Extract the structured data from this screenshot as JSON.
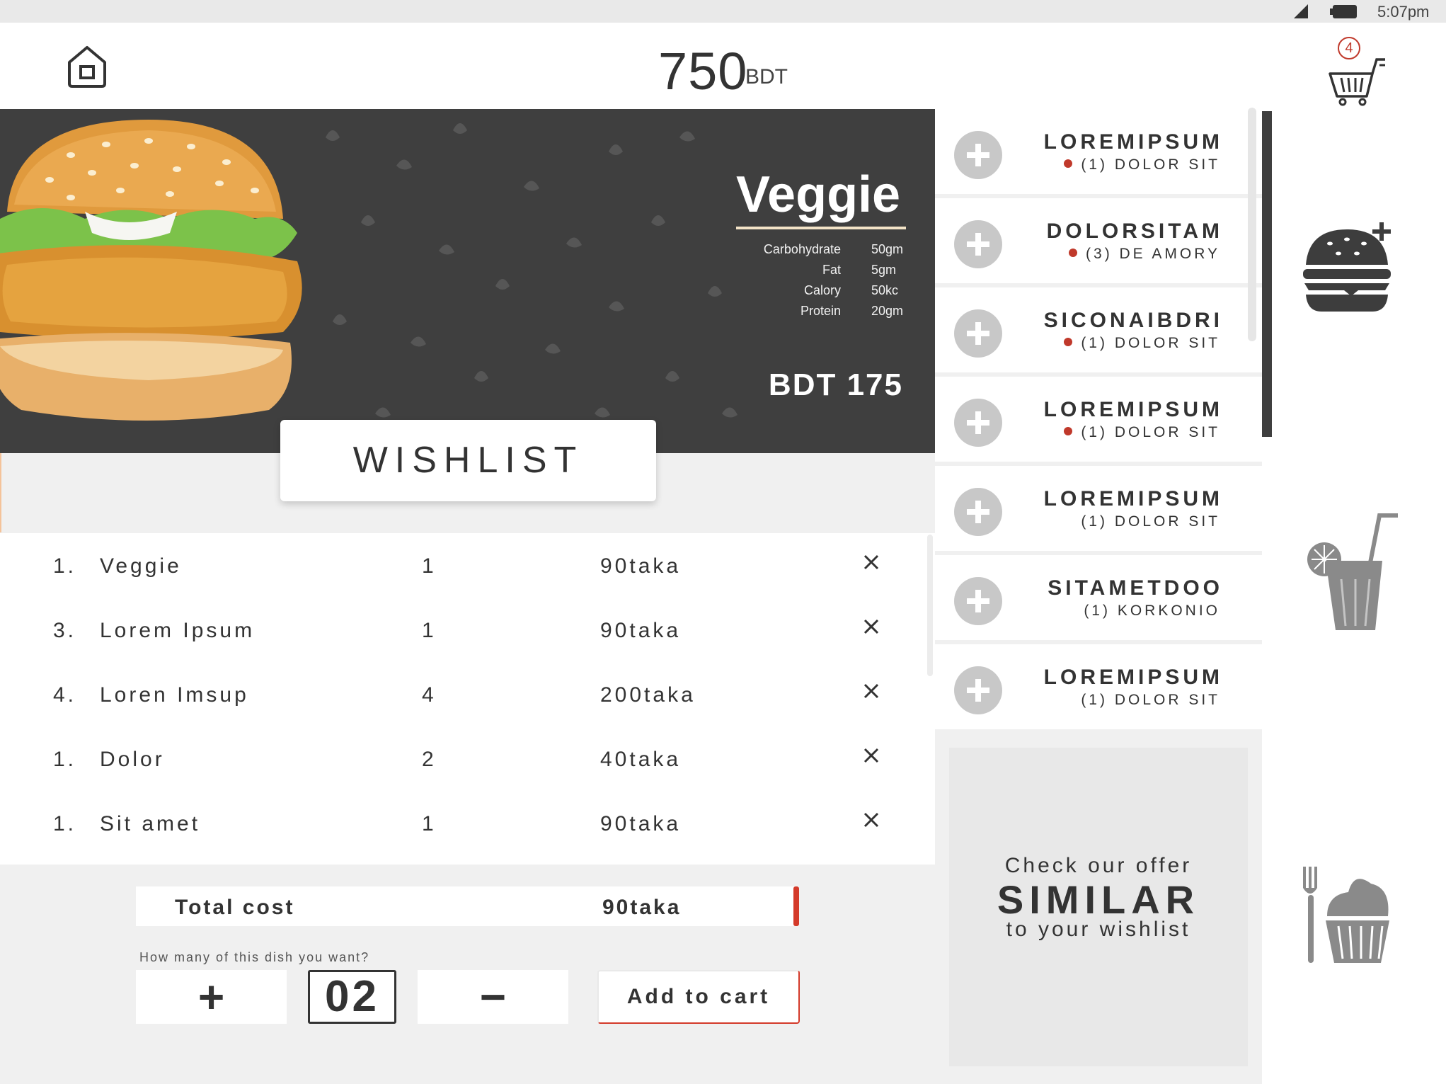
{
  "status": {
    "time": "5:07pm"
  },
  "header": {
    "balance": "750",
    "balance_unit": "BDT",
    "cart_count": "4"
  },
  "hero": {
    "title": "Veggie",
    "nutrition": [
      {
        "label": "Carbohydrate",
        "value": "50gm"
      },
      {
        "label": "Fat",
        "value": "5gm"
      },
      {
        "label": "Calory",
        "value": "50kc"
      },
      {
        "label": "Protein",
        "value": "20gm"
      }
    ],
    "price": "BDT 175"
  },
  "wishlist_tab": "WISHLIST",
  "wishlist": [
    {
      "idx": "1.",
      "name": "Veggie",
      "qty": "1",
      "price": "90taka"
    },
    {
      "idx": "3.",
      "name": "Lorem Ipsum",
      "qty": "1",
      "price": "90taka"
    },
    {
      "idx": "4.",
      "name": "Loren Imsup",
      "qty": "4",
      "price": "200taka"
    },
    {
      "idx": "1.",
      "name": "Dolor",
      "qty": "2",
      "price": "40taka"
    },
    {
      "idx": "1.",
      "name": "Sit amet",
      "qty": "1",
      "price": "90taka"
    }
  ],
  "total": {
    "label": "Total cost",
    "value": "90taka"
  },
  "quantity": {
    "question": "How many of this dish you want?",
    "value": "02",
    "plus": "+",
    "minus": "−"
  },
  "add_to_cart": "Add to cart",
  "menu": [
    {
      "name": "LOREMIPSUM",
      "sub": "(1) DOLOR SIT",
      "dot": true
    },
    {
      "name": "DOLORSITAM",
      "sub": "(3) DE AMORY",
      "dot": true
    },
    {
      "name": "SICONAIBDRI",
      "sub": "(1) DOLOR SIT",
      "dot": true
    },
    {
      "name": "LOREMIPSUM",
      "sub": "(1) DOLOR SIT",
      "dot": true
    },
    {
      "name": "LOREMIPSUM",
      "sub": "(1) DOLOR SIT",
      "dot": false
    },
    {
      "name": "SITAMETDOO",
      "sub": "(1) KORKONIO",
      "dot": false
    },
    {
      "name": "LOREMIPSUM",
      "sub": "(1) DOLOR SIT",
      "dot": false
    }
  ],
  "offer": {
    "top": "Check our offer",
    "mid": "SIMILAR",
    "bottom": "to your wishlist"
  },
  "categories": [
    "burger-icon",
    "drink-icon",
    "dessert-icon"
  ],
  "colors": {
    "accent": "#d43a2a",
    "dark": "#3f3f3f",
    "dot": "#c0392b"
  }
}
